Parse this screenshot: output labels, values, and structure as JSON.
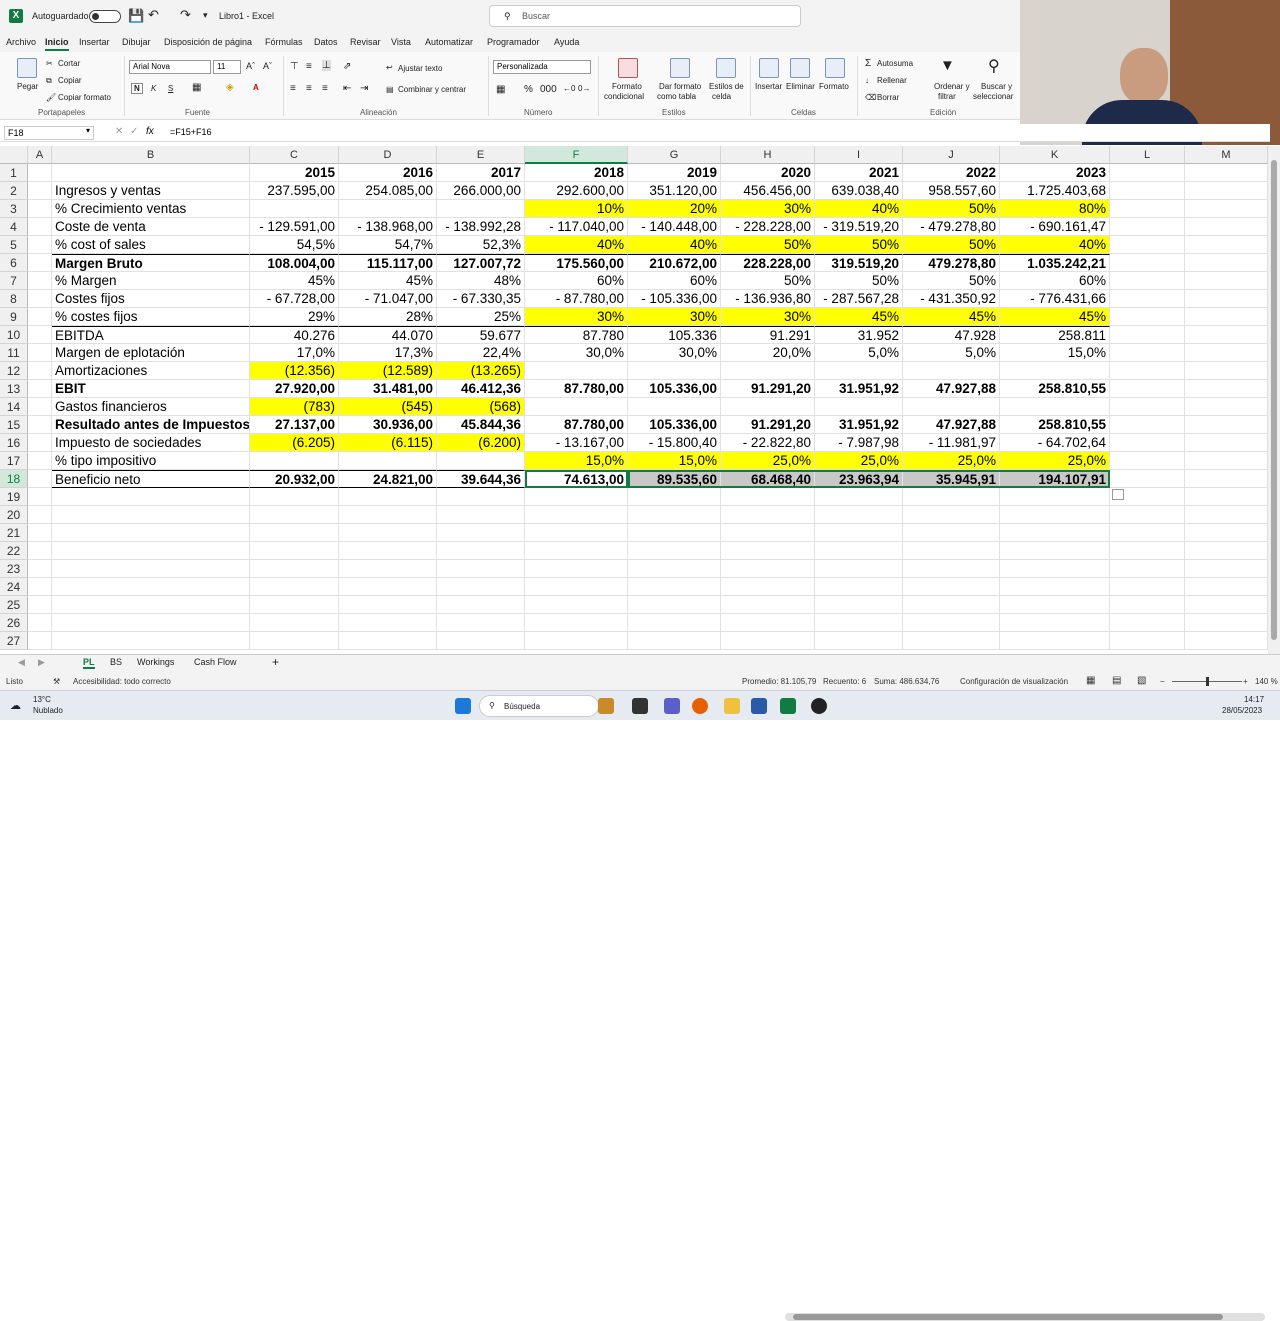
{
  "titlebar": {
    "autosave_label": "Autoguardado",
    "doc_title": "Libro1 - Excel",
    "search_placeholder": "Buscar"
  },
  "menu": [
    "Archivo",
    "Inicio",
    "Insertar",
    "Dibujar",
    "Disposición de página",
    "Fórmulas",
    "Datos",
    "Revisar",
    "Vista",
    "Automatizar",
    "Programador",
    "Ayuda"
  ],
  "ribbon": {
    "pegar": "Pegar",
    "cortar": "Cortar",
    "copiar": "Copiar",
    "copiar_formato": "Copiar formato",
    "portapapeles": "Portapapeles",
    "font_name": "Arial Nova",
    "font_size": "11",
    "fuente": "Fuente",
    "ajustar_texto": "Ajustar texto",
    "combinar": "Combinar y centrar",
    "alineacion": "Alineación",
    "number_format": "Personalizada",
    "numero": "Número",
    "formato_condicional_1": "Formato",
    "formato_condicional_2": "condicional",
    "dar_formato_1": "Dar formato",
    "dar_formato_2": "como tabla",
    "estilos_celda_1": "Estilos de",
    "estilos_celda_2": "celda",
    "estilos": "Estilos",
    "insertar": "Insertar",
    "eliminar": "Eliminar",
    "formato": "Formato",
    "celdas": "Celdas",
    "autosuma": "Autosuma",
    "rellenar": "Rellenar",
    "borrar": "Borrar",
    "ordenar_1": "Ordenar y",
    "ordenar_2": "filtrar",
    "buscar_1": "Buscar y",
    "buscar_2": "seleccionar",
    "edicion": "Edición"
  },
  "formula_bar": {
    "name_box": "F18",
    "formula": "=F15+F16"
  },
  "columns": [
    "A",
    "B",
    "C",
    "D",
    "E",
    "F",
    "G",
    "H",
    "I",
    "J",
    "K",
    "L",
    "M"
  ],
  "rows": [
    "1",
    "2",
    "3",
    "4",
    "5",
    "6",
    "7",
    "8",
    "9",
    "10",
    "11",
    "12",
    "13",
    "14",
    "15",
    "16",
    "17",
    "18",
    "19",
    "20",
    "21",
    "22",
    "23",
    "24",
    "25",
    "26",
    "27"
  ],
  "sheet": [
    [
      "",
      "2015",
      "2016",
      "2017",
      "2018",
      "2019",
      "2020",
      "2021",
      "2022",
      "2023"
    ],
    [
      "Ingresos y ventas",
      "237.595,00",
      "254.085,00",
      "266.000,00",
      "292.600,00",
      "351.120,00",
      "456.456,00",
      "639.038,40",
      "958.557,60",
      "1.725.403,68"
    ],
    [
      "% Crecimiento ventas",
      "",
      "",
      "",
      "10%",
      "20%",
      "30%",
      "40%",
      "50%",
      "80%"
    ],
    [
      "Coste de venta",
      "- 129.591,00",
      "- 138.968,00",
      "- 138.992,28",
      "- 117.040,00",
      "- 140.448,00",
      "- 228.228,00",
      "- 319.519,20",
      "- 479.278,80",
      "- 690.161,47"
    ],
    [
      "% cost of sales",
      "54,5%",
      "54,7%",
      "52,3%",
      "40%",
      "40%",
      "50%",
      "50%",
      "50%",
      "40%"
    ],
    [
      "Margen Bruto",
      "108.004,00",
      "115.117,00",
      "127.007,72",
      "175.560,00",
      "210.672,00",
      "228.228,00",
      "319.519,20",
      "479.278,80",
      "1.035.242,21"
    ],
    [
      "% Margen",
      "45%",
      "45%",
      "48%",
      "60%",
      "60%",
      "50%",
      "50%",
      "50%",
      "60%"
    ],
    [
      "Costes fijos",
      "- 67.728,00",
      "- 71.047,00",
      "- 67.330,35",
      "- 87.780,00",
      "- 105.336,00",
      "- 136.936,80",
      "- 287.567,28",
      "- 431.350,92",
      "- 776.431,66"
    ],
    [
      "% costes fijos",
      "29%",
      "28%",
      "25%",
      "30%",
      "30%",
      "30%",
      "45%",
      "45%",
      "45%"
    ],
    [
      "EBITDA",
      "40.276",
      "44.070",
      "59.677",
      "87.780",
      "105.336",
      "91.291",
      "31.952",
      "47.928",
      "258.811"
    ],
    [
      "Margen de eplotación",
      "17,0%",
      "17,3%",
      "22,4%",
      "30,0%",
      "30,0%",
      "20,0%",
      "5,0%",
      "5,0%",
      "15,0%"
    ],
    [
      "Amortizaciones",
      "(12.356)",
      "(12.589)",
      "(13.265)",
      "",
      "",
      "",
      "",
      "",
      ""
    ],
    [
      "EBIT",
      "27.920,00",
      "31.481,00",
      "46.412,36",
      "87.780,00",
      "105.336,00",
      "91.291,20",
      "31.951,92",
      "47.927,88",
      "258.810,55"
    ],
    [
      "Gastos financieros",
      "(783)",
      "(545)",
      "(568)",
      "",
      "",
      "",
      "",
      "",
      ""
    ],
    [
      "Resultado antes de Impuestos",
      "27.137,00",
      "30.936,00",
      "45.844,36",
      "87.780,00",
      "105.336,00",
      "91.291,20",
      "31.951,92",
      "47.927,88",
      "258.810,55"
    ],
    [
      "Impuesto de sociedades",
      "(6.205)",
      "(6.115)",
      "(6.200)",
      "- 13.167,00",
      "- 15.800,40",
      "- 22.822,80",
      "- 7.987,98",
      "- 11.981,97",
      "- 64.702,64"
    ],
    [
      "% tipo impositivo",
      "",
      "",
      "",
      "15,0%",
      "15,0%",
      "25,0%",
      "25,0%",
      "25,0%",
      "25,0%"
    ],
    [
      "Beneficio neto",
      "20.932,00",
      "24.821,00",
      "39.644,36",
      "74.613,00",
      "89.535,60",
      "68.468,40",
      "23.963,94",
      "35.945,91",
      "194.107,91"
    ]
  ],
  "tabs": [
    "PL",
    "BS",
    "Workings",
    "Cash Flow"
  ],
  "status": {
    "ready": "Listo",
    "accessibility": "Accesibilidad: todo correcto",
    "average": "Promedio: 81.105,79",
    "count": "Recuento: 6",
    "sum": "Suma: 486.634,76",
    "view_config": "Configuración de visualización",
    "zoom": "140 %"
  },
  "taskbar": {
    "temp": "13°C",
    "weather": "Nublado",
    "search": "Búsqueda",
    "time": "14:17",
    "date": "28/05/2023"
  },
  "colors": {
    "excel_green": "#107c41",
    "highlight_yellow": "#ffff00",
    "selected_gray": "#c8c8c8"
  }
}
